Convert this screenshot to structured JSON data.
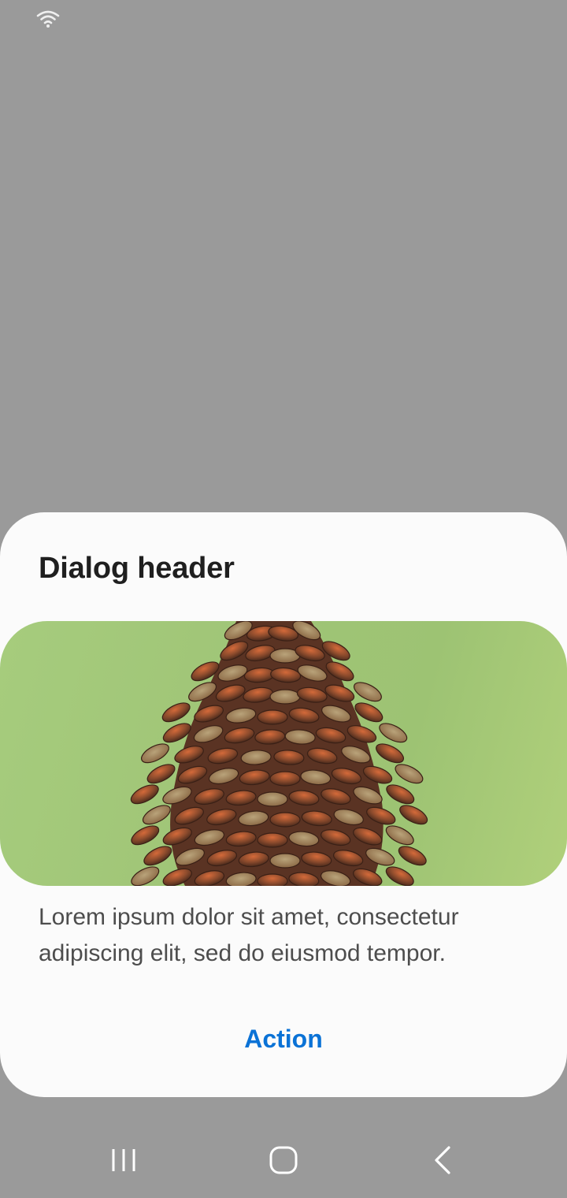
{
  "status_bar": {
    "wifi_icon": "wifi-icon"
  },
  "dialog": {
    "header": "Dialog header",
    "body": "Lorem ipsum dolor sit amet, consectetur adipiscing elit, sed do eiusmod tempor.",
    "action_label": "Action",
    "image": "pinecone photo on green background"
  },
  "nav_bar": {
    "recents_icon": "recents-icon",
    "home_icon": "home-icon",
    "back_icon": "back-icon"
  },
  "colors": {
    "scrim": "#9a9a9a",
    "dialog_bg": "#fbfbfb",
    "action": "#0a72d6",
    "image_bg": "#a6cc7d"
  }
}
